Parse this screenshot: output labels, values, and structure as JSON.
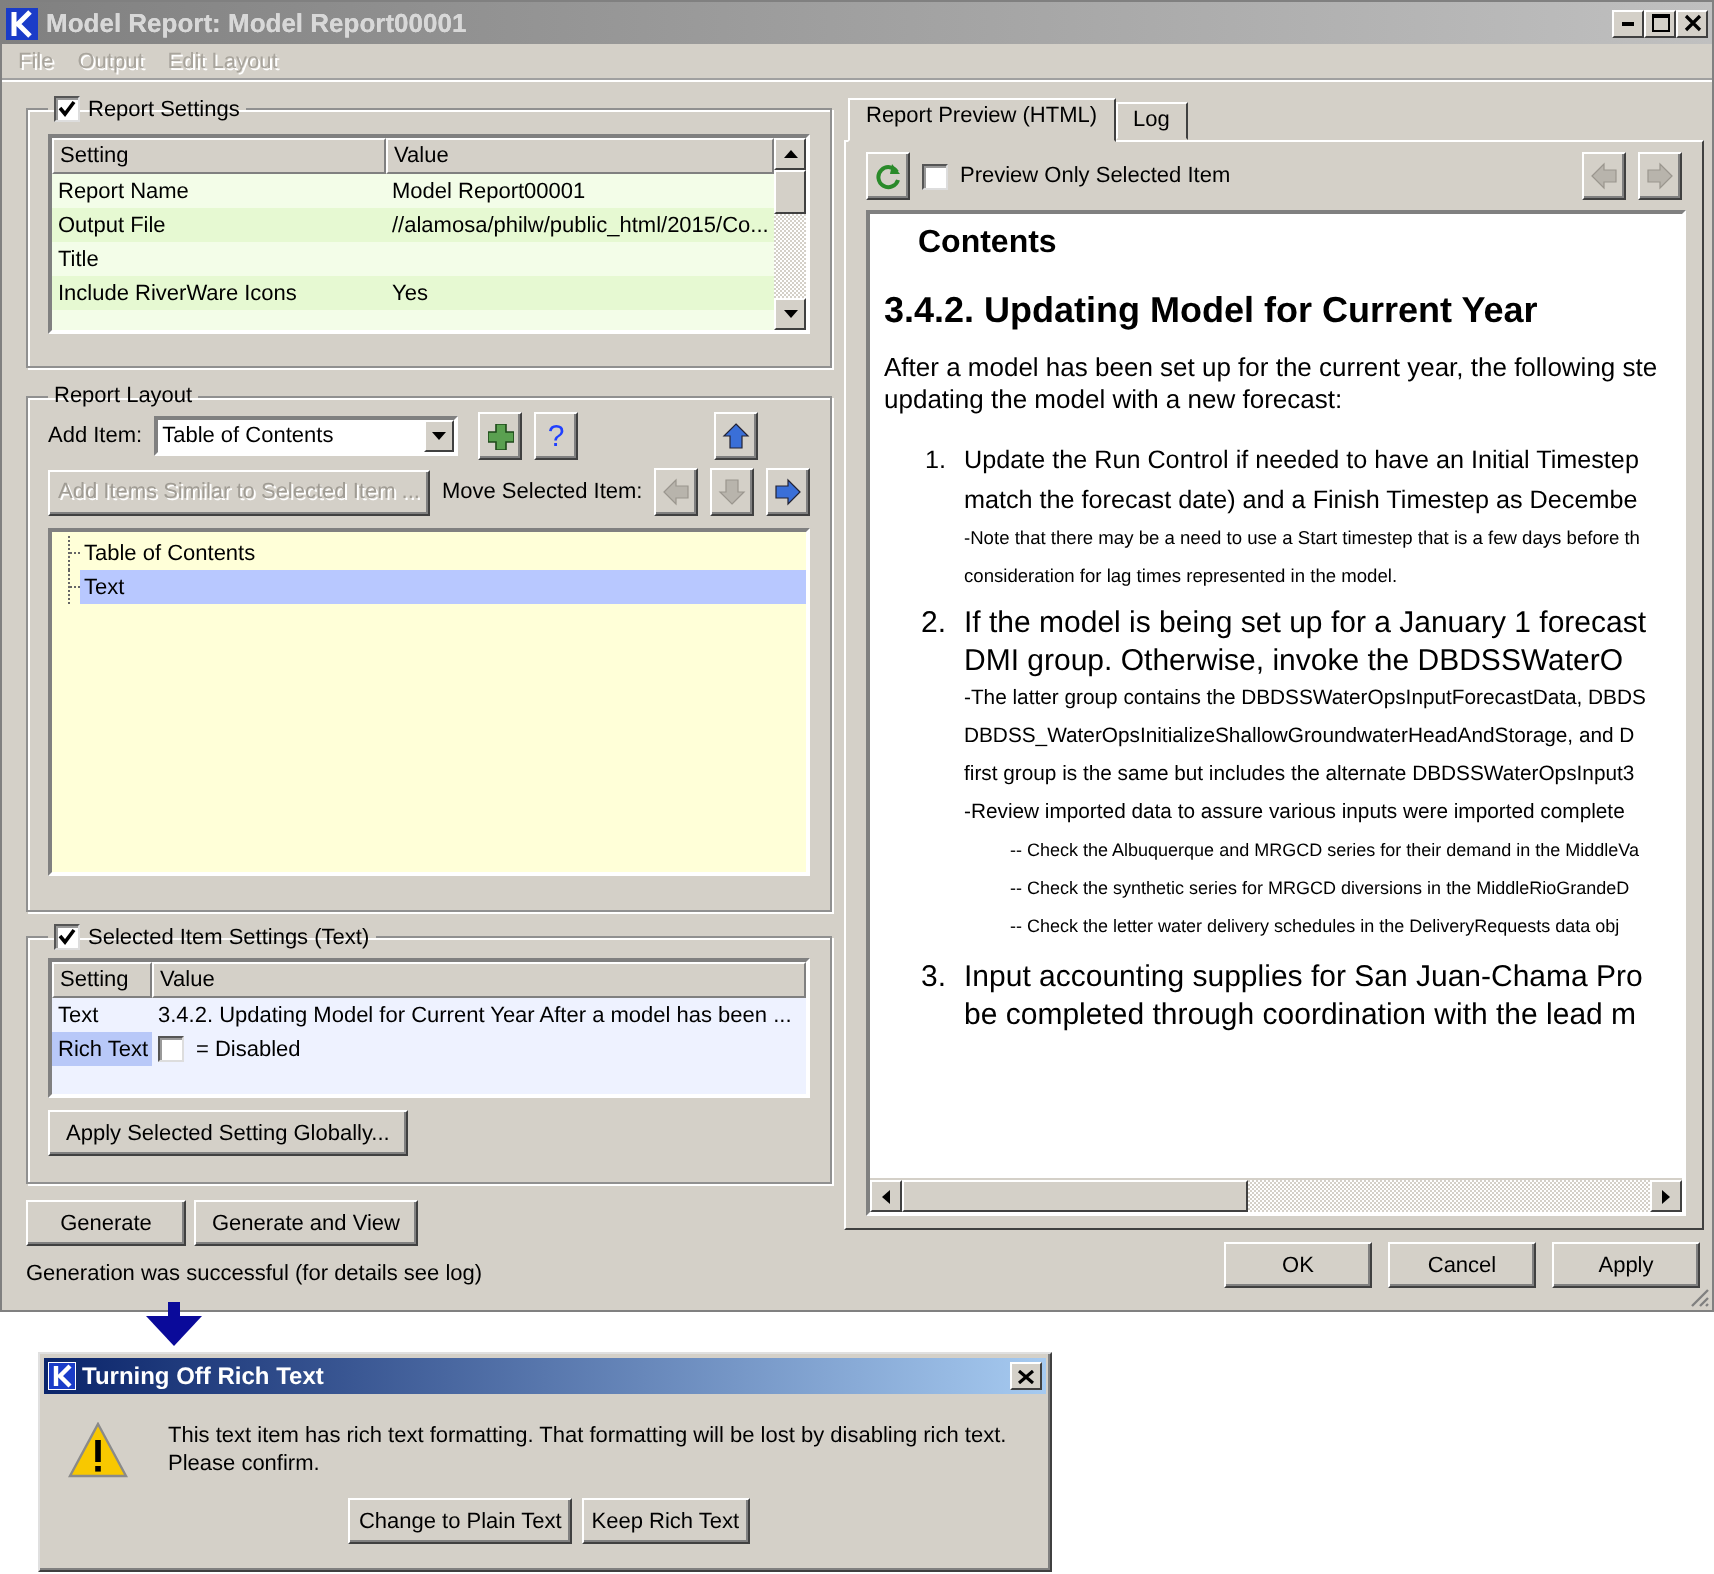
{
  "window": {
    "title": "Model Report: Model Report00001"
  },
  "menu": [
    "File",
    "Output",
    "Edit Layout"
  ],
  "report_settings": {
    "label": "Report Settings",
    "checked": true,
    "columns": [
      "Setting",
      "Value"
    ],
    "rows": [
      {
        "setting": "Report Name",
        "value": "Model Report00001"
      },
      {
        "setting": "Output File",
        "value": "//alamosa/philw/public_html/2015/Co..."
      },
      {
        "setting": "Title",
        "value": ""
      },
      {
        "setting": "Include RiverWare Icons",
        "value": "Yes"
      }
    ]
  },
  "report_layout": {
    "label": "Report Layout",
    "add_item_label": "Add Item:",
    "add_item_value": "Table of Contents",
    "help_label": "?",
    "move_up": {
      "disabled": false
    },
    "add_similar": {
      "label": "Add Items Similar to Selected Item ...",
      "disabled": true
    },
    "move_label": "Move Selected Item:",
    "move_buttons": [
      {
        "kind": "left",
        "disabled": true
      },
      {
        "kind": "down",
        "disabled": true
      },
      {
        "kind": "right",
        "disabled": false
      }
    ],
    "items": [
      {
        "label": "Table of Contents",
        "selected": false
      },
      {
        "label": "Text",
        "selected": true
      }
    ]
  },
  "selected_item_settings": {
    "label": "Selected Item Settings (Text)",
    "checked": true,
    "columns": [
      "Setting",
      "Value"
    ],
    "rows": [
      {
        "kind": "text",
        "setting": "Text",
        "value": "3.4.2. Updating Model for Current Year  After a model has been ...",
        "selected": false
      },
      {
        "kind": "checkbox",
        "setting": "Rich Text",
        "checked": false,
        "value": "= Disabled",
        "selected": true
      }
    ],
    "apply_button": "Apply Selected Setting Globally..."
  },
  "buttons_left": [
    "Generate",
    "Generate and View"
  ],
  "status": "Generation was successful (for details see log)",
  "tabs": [
    {
      "label": "Report Preview (HTML)",
      "selected": true
    },
    {
      "label": "Log",
      "selected": false
    }
  ],
  "preview_toolbar": {
    "preview_only_selected": {
      "label": "Preview Only Selected Item",
      "checked": false
    },
    "back": {
      "disabled": true
    },
    "forward": {
      "disabled": true
    }
  },
  "preview": [
    {
      "kind": "toc",
      "lines": [
        "Contents"
      ]
    },
    {
      "kind": "heading",
      "lines": [
        "3.4.2. Updating Model for Current Year"
      ]
    },
    {
      "kind": "para",
      "lines": [
        "After a model has been set up for the current year, the following ste",
        "updating the model with a new forecast:"
      ]
    },
    {
      "kind": "item_small",
      "number": "1.",
      "lines": [
        "Update the Run Control if needed to have an Initial Timestep",
        "match the forecast date) and a Finish Timestep as Decembe"
      ]
    },
    {
      "kind": "note",
      "lines": [
        "-Note that there may be a need to use a Start timestep that is a few days before th",
        "consideration for lag times represented in the model."
      ]
    },
    {
      "kind": "item",
      "number": "2.",
      "lines": [
        "If the model is being set up for a January 1 forecast",
        "DMI group.  Otherwise, invoke the DBDSSWaterO"
      ]
    },
    {
      "kind": "note",
      "lines": [
        "-The latter group contains the DBDSSWaterOpsInputForecastData, DBDS",
        "DBDSS_WaterOpsInitializeShallowGroundwaterHeadAndStorage, and D",
        "first group is the same but includes the alternate DBDSSWaterOpsInput3",
        "-Review imported data to assure various inputs were imported complete"
      ]
    },
    {
      "kind": "subnote",
      "lines": [
        "-- Check the Albuquerque and MRGCD series for their demand in the MiddleVa",
        "-- Check the synthetic series for MRGCD diversions in the MiddleRioGrandeD",
        "-- Check the letter water delivery schedules in the DeliveryRequests data obj"
      ]
    },
    {
      "kind": "item",
      "number": "3.",
      "lines": [
        "Input accounting supplies for San Juan-Chama Pro",
        "be completed through coordination with the lead m"
      ]
    }
  ],
  "buttons_right": [
    "OK",
    "Cancel",
    "Apply"
  ],
  "dialog": {
    "title": "Turning Off Rich Text",
    "message": [
      "This text item has rich text formatting. That formatting will be lost by disabling rich text.",
      "Please confirm."
    ],
    "buttons": [
      "Change to Plain Text",
      "Keep Rich Text"
    ]
  }
}
